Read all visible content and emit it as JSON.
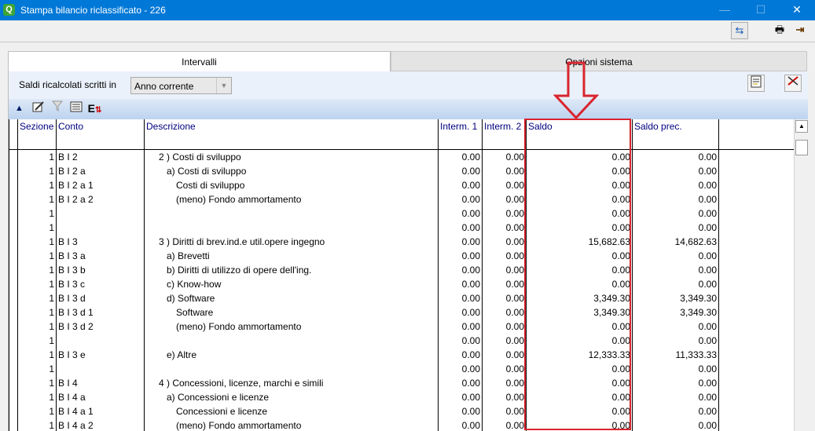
{
  "window": {
    "title": "Stampa bilancio riclassificato - 226",
    "minimize": "—",
    "maximize": "☐",
    "close": "✕"
  },
  "toolbar": {
    "refresh_icon": "⇆",
    "print_icon": "🖶",
    "exit_icon": "⇥"
  },
  "tabs": [
    {
      "label": "Intervalli"
    },
    {
      "label": "Opzioni sistema"
    }
  ],
  "filter": {
    "label": "Saldi ricalcolati scritti in",
    "selected": "Anno corrente"
  },
  "grid": {
    "columns": [
      "Sezione",
      "Conto",
      "Descrizione",
      "Interm. 1",
      "Interm. 2",
      "Saldo",
      "Saldo prec."
    ],
    "rows": [
      {
        "sezione": "1",
        "conto": "B I  2",
        "descr": "2 ) Costi di sviluppo",
        "indent": 1,
        "i1": "0.00",
        "i2": "0.00",
        "saldo": "0.00",
        "prec": "0.00"
      },
      {
        "sezione": "1",
        "conto": "B I  2  a",
        "descr": "a) Costi di sviluppo",
        "indent": 2,
        "i1": "0.00",
        "i2": "0.00",
        "saldo": "0.00",
        "prec": "0.00"
      },
      {
        "sezione": "1",
        "conto": "B I  2  a 1",
        "descr": "Costi di sviluppo",
        "indent": 3,
        "i1": "0.00",
        "i2": "0.00",
        "saldo": "0.00",
        "prec": "0.00"
      },
      {
        "sezione": "1",
        "conto": "B I  2  a 2",
        "descr": "(meno) Fondo ammortamento",
        "indent": 3,
        "i1": "0.00",
        "i2": "0.00",
        "saldo": "0.00",
        "prec": "0.00"
      },
      {
        "sezione": "1",
        "conto": "",
        "descr": "",
        "indent": 0,
        "i1": "0.00",
        "i2": "0.00",
        "saldo": "0.00",
        "prec": "0.00"
      },
      {
        "sezione": "1",
        "conto": "",
        "descr": "",
        "indent": 0,
        "i1": "0.00",
        "i2": "0.00",
        "saldo": "0.00",
        "prec": "0.00"
      },
      {
        "sezione": "1",
        "conto": "B I  3",
        "descr": "3 ) Diritti di brev.ind.e util.opere ingegno",
        "indent": 1,
        "i1": "0.00",
        "i2": "0.00",
        "saldo": "15,682.63",
        "prec": "14,682.63"
      },
      {
        "sezione": "1",
        "conto": "B I  3  a",
        "descr": "a) Brevetti",
        "indent": 2,
        "i1": "0.00",
        "i2": "0.00",
        "saldo": "0.00",
        "prec": "0.00"
      },
      {
        "sezione": "1",
        "conto": "B I  3  b",
        "descr": "b) Diritti di utilizzo di opere dell'ing.",
        "indent": 2,
        "i1": "0.00",
        "i2": "0.00",
        "saldo": "0.00",
        "prec": "0.00"
      },
      {
        "sezione": "1",
        "conto": "B I  3  c",
        "descr": "c) Know-how",
        "indent": 2,
        "i1": "0.00",
        "i2": "0.00",
        "saldo": "0.00",
        "prec": "0.00"
      },
      {
        "sezione": "1",
        "conto": "B I  3  d",
        "descr": "d) Software",
        "indent": 2,
        "i1": "0.00",
        "i2": "0.00",
        "saldo": "3,349.30",
        "prec": "3,349.30"
      },
      {
        "sezione": "1",
        "conto": "B I  3  d 1",
        "descr": "Software",
        "indent": 3,
        "i1": "0.00",
        "i2": "0.00",
        "saldo": "3,349.30",
        "prec": "3,349.30"
      },
      {
        "sezione": "1",
        "conto": "B I  3  d 2",
        "descr": "(meno) Fondo ammortamento",
        "indent": 3,
        "i1": "0.00",
        "i2": "0.00",
        "saldo": "0.00",
        "prec": "0.00"
      },
      {
        "sezione": "1",
        "conto": "",
        "descr": "",
        "indent": 0,
        "i1": "0.00",
        "i2": "0.00",
        "saldo": "0.00",
        "prec": "0.00"
      },
      {
        "sezione": "1",
        "conto": "B I  3  e",
        "descr": "e) Altre",
        "indent": 2,
        "i1": "0.00",
        "i2": "0.00",
        "saldo": "12,333.33",
        "prec": "11,333.33"
      },
      {
        "sezione": "1",
        "conto": "",
        "descr": "",
        "indent": 0,
        "i1": "0.00",
        "i2": "0.00",
        "saldo": "0.00",
        "prec": "0.00"
      },
      {
        "sezione": "1",
        "conto": "B I  4",
        "descr": "4 ) Concessioni, licenze, marchi e simili",
        "indent": 1,
        "i1": "0.00",
        "i2": "0.00",
        "saldo": "0.00",
        "prec": "0.00"
      },
      {
        "sezione": "1",
        "conto": "B I  4  a",
        "descr": "a) Concessioni e licenze",
        "indent": 2,
        "i1": "0.00",
        "i2": "0.00",
        "saldo": "0.00",
        "prec": "0.00"
      },
      {
        "sezione": "1",
        "conto": "B I  4  a 1",
        "descr": "Concessioni e licenze",
        "indent": 3,
        "i1": "0.00",
        "i2": "0.00",
        "saldo": "0.00",
        "prec": "0.00"
      },
      {
        "sezione": "1",
        "conto": "B I  4  a 2",
        "descr": "(meno) Fondo ammortamento",
        "indent": 3,
        "i1": "0.00",
        "i2": "0.00",
        "saldo": "0.00",
        "prec": "0.00"
      }
    ]
  },
  "colors": {
    "titlebar": "#0078d7",
    "header_text": "#000080",
    "highlight": "#d9252f"
  }
}
